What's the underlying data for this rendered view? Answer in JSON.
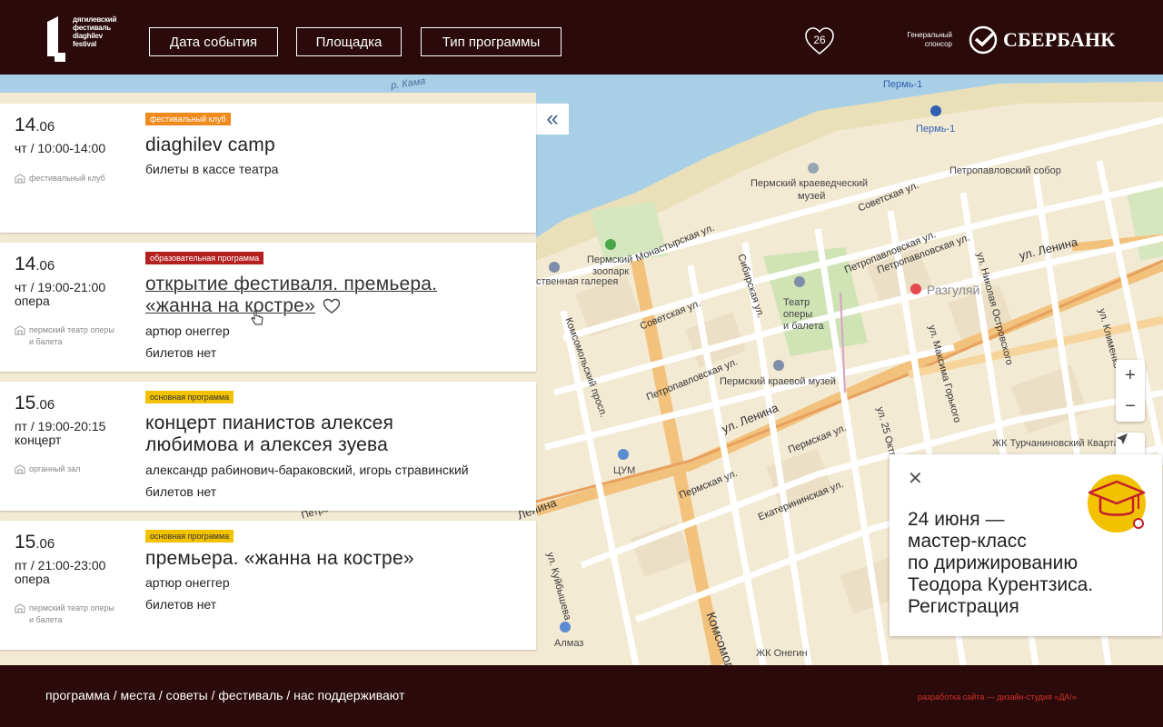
{
  "header": {
    "logo_lines": [
      "дягилевский",
      "фестиваль",
      "diaghilev",
      "festival"
    ],
    "filters": [
      "Дата события",
      "Площадка",
      "Тип программы"
    ],
    "favorites_count": "26",
    "sponsor_label_1": "Генеральный",
    "sponsor_label_2": "спонсор",
    "sponsor_name": "СБЕРБАНК"
  },
  "colors": {
    "background": "#2a0a0a",
    "tag_club": "#f08a1d",
    "tag_education": "#b41f1f",
    "tag_main": "#f2c100",
    "credit": "#d0322a"
  },
  "map": {
    "labels": {
      "kama": "р. Кама",
      "perm1_a": "Пермь-1",
      "perm1_b": "Пермь-1",
      "cathedral": "Петропавловский собор",
      "museum_1": "Пермский краеведческий",
      "museum_2": "музей",
      "zoo_1": "Пермский",
      "zoo_2": "зоопарк",
      "gallery": "ственная галерея",
      "theatre_1": "Театр",
      "theatre_2": "оперы",
      "theatre_3": "и балета",
      "museum_b": "Пермский краевой музей",
      "razgulyay": "Разгуляй",
      "tsum": "ЦУМ",
      "almaz": "Алмаз",
      "turch": "ЖК Турчаниновский Квартал",
      "onegin": "ЖК Онегин"
    },
    "streets": {
      "monastyrskaya": "Монастырская ул.",
      "sibirskaya": "Сибирская ул.",
      "sovetskaya_a": "Советская ул.",
      "sovetskaya_b": "Советская ул.",
      "petropavlovskaya_a": "Петропавловская ул.",
      "petropavlovskaya_b": "Петропавловская ул.",
      "petropavlovskaya_c": "Петропавловская ул.",
      "komsomolsky": "Комсомольский просп.",
      "lenina_a": "ул. Ленина",
      "lenina_b": "ул. Ленина",
      "lenina_c": "Ленина",
      "permskaya_a": "Пермская ул.",
      "permskaya_b": "Пермская ул.",
      "ekaterininskaya": "Екатерининская ул.",
      "kuybysheva": "ул. Куйбышева",
      "gorkogo": "ул. Максима Горького",
      "oktyabrya": "ул. 25 Октября",
      "ostrovskogo": "ул. Николая Островского",
      "klimenko": "ул. Клименко",
      "komsomolsky_b": "Комсомол",
      "petro_left": "Петро"
    },
    "zoom_in": "+",
    "zoom_out": "−"
  },
  "collapse_label": "«",
  "events": [
    {
      "date_day": "14",
      "date_month": ".06",
      "time": "чт / 10:00-14:00",
      "genre": "",
      "venue_1": "фестивальный клуб",
      "venue_2": "",
      "tag": "фестивальный клуб",
      "title_1": "diaghilev camp",
      "title_2": "",
      "line_1": "билеты в кассе театра",
      "line_2": ""
    },
    {
      "date_day": "14",
      "date_month": ".06",
      "time": "чт / 19:00-21:00",
      "genre": "опера",
      "venue_1": "пермский театр оперы",
      "venue_2": "и балета",
      "tag": "образовательная программа",
      "title_1": "открытие фестиваля. премьера.",
      "title_2": "«жанна на костре»",
      "line_1": "артюр онеггер",
      "line_2": "билетов нет"
    },
    {
      "date_day": "15",
      "date_month": ".06",
      "time": "пт / 19:00-20:15",
      "genre": "концерт",
      "venue_1": "органный зал",
      "venue_2": "",
      "tag": "основная программа",
      "title_1": "концерт пианистов алексея",
      "title_2": "любимова и алексея зуева",
      "line_1": "александр рабинович-бараковский, игорь стравинский",
      "line_2": "билетов нет"
    },
    {
      "date_day": "15",
      "date_month": ".06",
      "time": "пт / 21:00-23:00",
      "genre": "опера",
      "venue_1": "пермский театр оперы",
      "venue_2": "и балета",
      "tag": "основная программа",
      "title_1": "премьера. «жанна на костре»",
      "title_2": "",
      "line_1": "артюр онеггер",
      "line_2": "билетов нет"
    }
  ],
  "promo": {
    "close": "✕",
    "line_1": "24 июня —",
    "line_2": "мастер-класс",
    "line_3": "по дирижированию",
    "line_4": "Теодора Курентзиса.",
    "line_5": "Регистрация"
  },
  "footer": {
    "nav": [
      "программа",
      "места",
      "советы",
      "фестиваль",
      "нас поддерживают"
    ],
    "separator": " / ",
    "credit": "разработка сайта — дизайн-студия «ДА!»"
  }
}
